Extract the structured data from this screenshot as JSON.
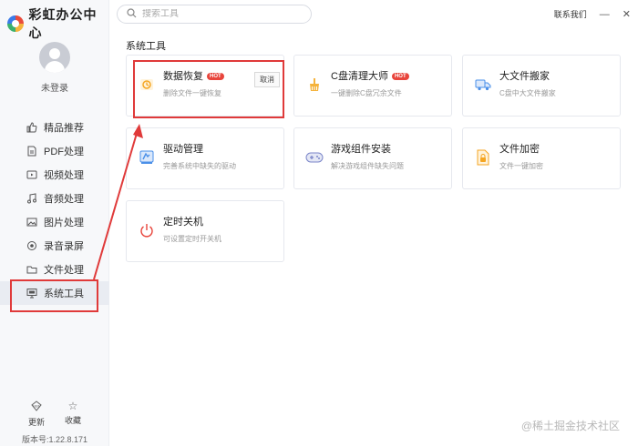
{
  "app": {
    "title": "彩虹办公中心"
  },
  "user": {
    "login_status": "未登录"
  },
  "search": {
    "placeholder": "搜索工具"
  },
  "header": {
    "contact": "联系我们",
    "minimize_icon": "minimize-icon",
    "close_icon": "close-icon"
  },
  "nav": {
    "items": [
      {
        "label": "精品推荐",
        "icon": "thumbs-up-icon"
      },
      {
        "label": "PDF处理",
        "icon": "pdf-icon"
      },
      {
        "label": "视频处理",
        "icon": "video-icon"
      },
      {
        "label": "音频处理",
        "icon": "music-icon"
      },
      {
        "label": "图片处理",
        "icon": "image-icon"
      },
      {
        "label": "录音录屏",
        "icon": "record-icon"
      },
      {
        "label": "文件处理",
        "icon": "folder-icon"
      },
      {
        "label": "系统工具",
        "icon": "monitor-icon",
        "active": true
      }
    ]
  },
  "bottom": {
    "update_label": "更新",
    "favorite_label": "收藏",
    "version": "版本号:1.22.8.171"
  },
  "section": {
    "title": "系统工具"
  },
  "tools": [
    {
      "title": "数据恢复",
      "badge": "HOT",
      "desc": "删除文件一键恢复",
      "action": "取消",
      "icon": "recovery-icon",
      "color": "#f5a623"
    },
    {
      "title": "C盘清理大师",
      "badge": "HOT",
      "desc": "一键删除C盘冗余文件",
      "icon": "broom-icon",
      "color": "#f5b33c"
    },
    {
      "title": "大文件搬家",
      "desc": "C盘中大文件搬家",
      "icon": "truck-icon",
      "color": "#4a8fe8"
    },
    {
      "title": "驱动管理",
      "desc": "完善系统中缺失的驱动",
      "icon": "driver-icon",
      "color": "#4a8fe8"
    },
    {
      "title": "游戏组件安装",
      "desc": "解决游戏组件缺失问题",
      "icon": "gamepad-icon",
      "color": "#7b86c9"
    },
    {
      "title": "文件加密",
      "desc": "文件一键加密",
      "icon": "lock-file-icon",
      "color": "#f5a623"
    },
    {
      "title": "定时关机",
      "desc": "可设置定时开关机",
      "icon": "power-icon",
      "color": "#e8453c"
    }
  ],
  "watermark": "@稀土掘金技术社区",
  "colors": {
    "highlight": "#e03a3a",
    "hot": "#e8453c"
  }
}
